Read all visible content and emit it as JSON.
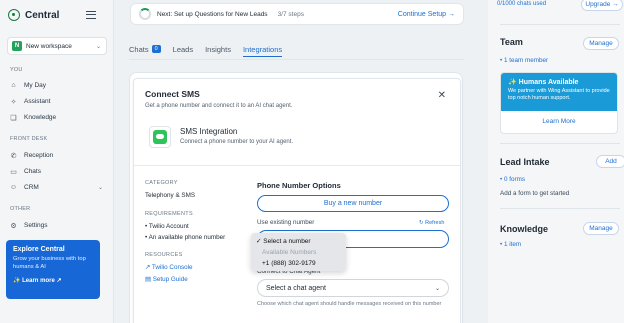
{
  "sidebar": {
    "brand": "Central",
    "workspace": {
      "badge": "N",
      "label": "New workspace"
    },
    "sections": [
      {
        "title": "YOU",
        "items": [
          {
            "label": "My Day",
            "icon": "home-icon"
          },
          {
            "label": "Assistant",
            "icon": "sparkle-icon"
          },
          {
            "label": "Knowledge",
            "icon": "book-icon"
          }
        ]
      },
      {
        "title": "FRONT DESK",
        "items": [
          {
            "label": "Reception",
            "icon": "phone-icon"
          },
          {
            "label": "Chats",
            "icon": "chat-icon"
          },
          {
            "label": "CRM",
            "icon": "people-icon"
          }
        ]
      },
      {
        "title": "OTHER",
        "items": [
          {
            "label": "Settings",
            "icon": "gear-icon"
          }
        ]
      }
    ],
    "promo": {
      "title": "Explore Central",
      "description": "Grow your business with top humans & AI",
      "link": "✨ Learn more ↗"
    }
  },
  "setup": {
    "text": "Next: Set up Questions for New Leads",
    "steps": "3/7 steps",
    "link": "Continue Setup →"
  },
  "tabs": [
    {
      "label": "Chats",
      "badge": "0"
    },
    {
      "label": "Leads"
    },
    {
      "label": "Insights"
    },
    {
      "label": "Integrations",
      "active": true
    }
  ],
  "modal": {
    "title": "Connect SMS",
    "subtitle": "Get a phone number and connect it to an AI chat agent.",
    "integration": {
      "title": "SMS Integration",
      "subtitle": "Connect a phone number to your AI agent."
    },
    "meta": {
      "category_h": "CATEGORY",
      "category": "Telephony & SMS",
      "requirements_h": "REQUIREMENTS",
      "requirements": [
        "Twilio Account",
        "An available phone number"
      ],
      "resources_h": "RESOURCES",
      "resources": [
        "Twilio Console",
        "Setup Guide"
      ]
    },
    "options_title": "Phone Number Options",
    "buy_button": "Buy a new number",
    "use_existing": "Use existing number",
    "refresh": "Refresh",
    "connect_label": "Connect to Chat Agent",
    "agent_select": "Select a chat agent",
    "agent_help": "Choose which chat agent should handle messages received on this number",
    "dropdown": {
      "selected": "✓ Select a number",
      "group": "Available Numbers",
      "numbers": [
        "+1 (888) 302-9179"
      ]
    }
  },
  "right": {
    "usage": "0/1000 chats used",
    "upgrade": "Upgrade →",
    "team": {
      "title": "Team",
      "button": "Manage",
      "count": "1 team member"
    },
    "humans": {
      "title": "Humans Available",
      "description": "We partner with Wing Assistant to provide top notch human support.",
      "more": "Learn More"
    },
    "lead_intake": {
      "title": "Lead Intake",
      "button": "Add",
      "count": "0 forms",
      "text": "Add a form to get started"
    },
    "knowledge": {
      "title": "Knowledge",
      "button": "Manage",
      "count": "1 item"
    }
  }
}
